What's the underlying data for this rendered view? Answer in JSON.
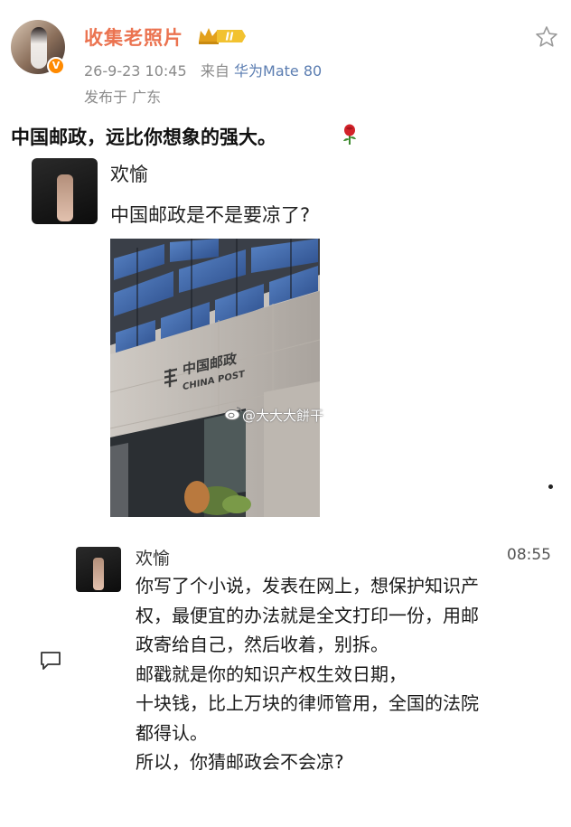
{
  "post": {
    "username": "收集老照片",
    "level_badge": "II",
    "verified_mark": "V",
    "date": "26-9-23 10:45",
    "source_prefix": "来自",
    "device": "华为Mate 80",
    "location": "发布于 广东",
    "title": "中国邮政，远比你想象的强大。"
  },
  "chat1": {
    "name": "欢愉",
    "message": "中国邮政是不是要凉了?"
  },
  "photo": {
    "sign_cn": "中国邮政",
    "sign_en": "CHINA POST"
  },
  "watermark": "@大大大餅干",
  "chat2": {
    "name": "欢愉",
    "time": "08:55",
    "lines": [
      "你写了个小说，发表在网上，想保护知识产",
      "权，最便宜的办法就是全文打印一份，用邮",
      "政寄给自己，然后收着，别拆。",
      "邮戳就是你的知识产权生效日期，",
      "十块钱，比上万块的律师管用，全国的法院",
      "都得认。",
      "所以，你猜邮政会不会凉?"
    ]
  },
  "icons": {
    "star": "star-icon",
    "comment": "comment-icon",
    "rose": "rose-emoji",
    "crown": "crown-badge-icon",
    "weibo": "weibo-logo-icon"
  },
  "colors": {
    "username": "#eb7350",
    "device": "#5b7db1",
    "meta": "#8a8a8a",
    "verified": "#ff8a00"
  }
}
